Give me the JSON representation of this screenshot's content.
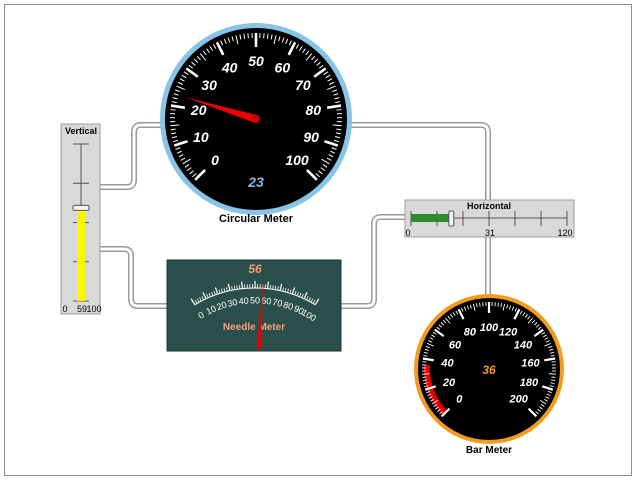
{
  "circular_meter": {
    "caption": "Circular Meter",
    "value": 23,
    "value_text": "23",
    "min": 0,
    "max": 100,
    "tick_labels": [
      "0",
      "10",
      "20",
      "30",
      "40",
      "50",
      "60",
      "70",
      "80",
      "90",
      "100"
    ],
    "ring_color": "#87c4e6",
    "face_color": "#000000",
    "needle_color": "#ee0000",
    "readout_color": "#7fb7e0"
  },
  "vertical_slider": {
    "title": "Vertical",
    "value": 59,
    "min": 0,
    "max": 100,
    "min_label": "0",
    "value_label": "59",
    "max_label": "100",
    "fill_color": "#f7f700",
    "panel_color": "#d9d9d9"
  },
  "needle_meter": {
    "caption": "Needle Meter",
    "value": 56,
    "value_text": "56",
    "min": 0,
    "max": 100,
    "tick_labels": [
      "0",
      "10",
      "20",
      "30",
      "40",
      "50",
      "60",
      "70",
      "80",
      "90",
      "100"
    ],
    "panel_color": "#2b4f4b",
    "needle_color": "#e60000",
    "caption_color": "#f5a27d",
    "readout_color": "#f39b73"
  },
  "horizontal_slider": {
    "title": "Horizontal",
    "value": 31,
    "min": 0,
    "max": 120,
    "min_label": "0",
    "value_label": "31",
    "max_label": "120",
    "fill_color": "#2e8b2e",
    "panel_color": "#d9d9d9"
  },
  "bar_meter": {
    "caption": "Bar Meter",
    "value": 36,
    "value_text": "36",
    "min": 0,
    "max": 200,
    "tick_labels": [
      "0",
      "20",
      "40",
      "60",
      "80",
      "100",
      "120",
      "140",
      "160",
      "180",
      "200"
    ],
    "ring_color": "#f29b1d",
    "bar_color": "#e00000",
    "readout_color": "#f29b1d"
  },
  "connector_color": "#9a9a9a"
}
